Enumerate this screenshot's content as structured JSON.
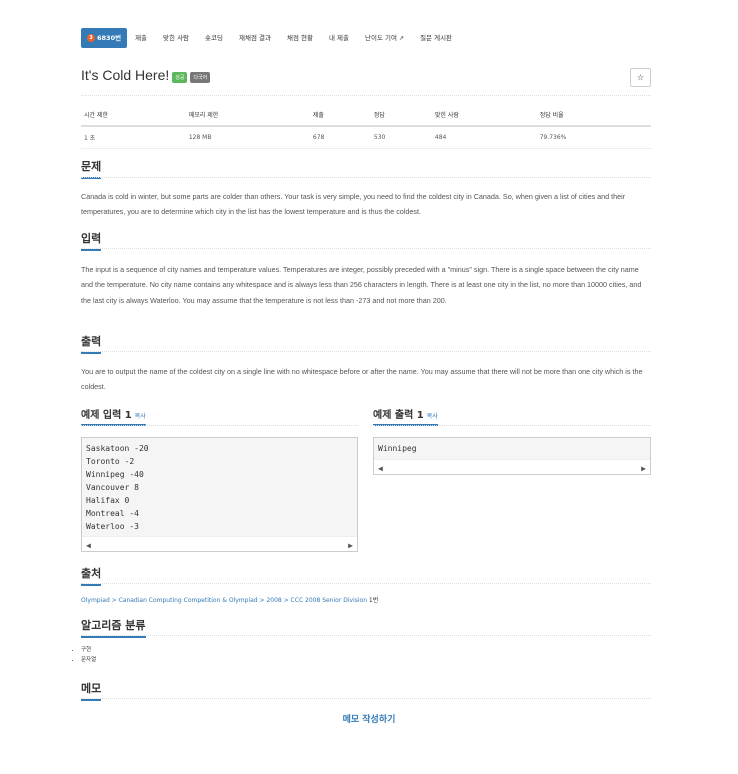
{
  "nav": {
    "tabs": [
      {
        "label": "6830번",
        "active": true,
        "tier": "3"
      },
      {
        "label": "제출"
      },
      {
        "label": "맞힌 사람"
      },
      {
        "label": "숏코딩"
      },
      {
        "label": "재채점 결과"
      },
      {
        "label": "채점 현황"
      },
      {
        "label": "내 제출"
      },
      {
        "label": "난이도 기여"
      },
      {
        "label": "질문 게시판"
      }
    ]
  },
  "problem": {
    "title": "It's Cold Here!",
    "badges": [
      "성공",
      "다국어"
    ],
    "star": "☆"
  },
  "info": {
    "headers": [
      "시간 제한",
      "메모리 제한",
      "제출",
      "정답",
      "맞힌 사람",
      "정답 비율"
    ],
    "values": [
      "1 초",
      "128 MB",
      "678",
      "530",
      "484",
      "79.736%"
    ]
  },
  "sections": {
    "problem_h": "문제",
    "problem_text": "Canada is cold in winter, but some parts are colder than others. Your task is very simple, you need to find the coldest city in Canada. So, when given a list of cities and their temperatures, you are to determine which city in the list has the lowest temperature and is thus the coldest.",
    "input_h": "입력",
    "input_text": "The input is a sequence of city names and temperature values. Temperatures are integer, possibly preceded with a \"minus\" sign. There is a single space between the city name and the temperature. No city name contains any whitespace and is always less than 256 characters in length. There is at least one city in the list, no more than 10000 cities, and the last city is always Waterloo. You may assume that the temperature is not less than -273 and not more than 200.",
    "output_h": "출력",
    "output_text": "You are to output the name of the coldest city on a single line with no whitespace before or after the name. You may assume that there will not be more than one city which is the coldest."
  },
  "samples": {
    "input_h": "예제 입력 1",
    "output_h": "예제 출력 1",
    "copy": "복사",
    "input_lines": [
      "Saskatoon -20",
      "Toronto -2",
      "Winnipeg -40",
      "Vancouver 8",
      "Halifax 0",
      "Montreal -4",
      "Waterloo -3"
    ],
    "output_lines": [
      "Winnipeg"
    ]
  },
  "source": {
    "h": "출처",
    "link": "Olympiad > Canadian Computing Competition & Olympiad > 2008 > CCC 2008 Senior Division",
    "suffix": "1번"
  },
  "algo": {
    "h": "알고리즘 분류",
    "items": [
      "구현",
      "문자열"
    ]
  },
  "memo": {
    "h": "메모",
    "button": "메모 작성하기"
  }
}
